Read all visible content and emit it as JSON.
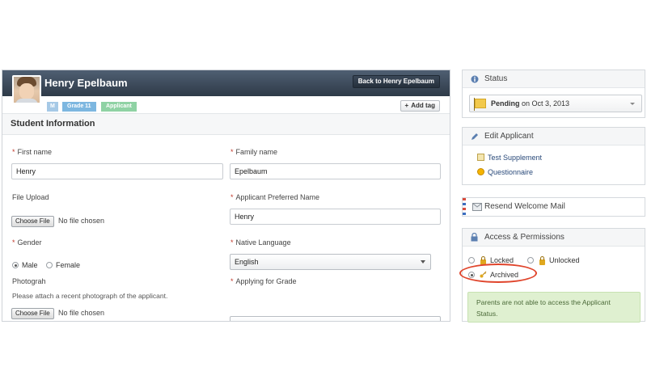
{
  "profile": {
    "name": "Henry Epelbaum",
    "back_button": "Back to Henry Epelbaum",
    "tags": [
      "M",
      "Grade 11",
      "Applicant"
    ],
    "add_tag": "Add tag"
  },
  "student_info": {
    "title": "Student Information",
    "first_name_label": "First name",
    "first_name_value": "Henry",
    "family_name_label": "Family name",
    "family_name_value": "Epelbaum",
    "file_upload_label": "File Upload",
    "choose_file": "Choose File",
    "no_file": "No file chosen",
    "preferred_name_label": "Applicant Preferred Name",
    "preferred_name_value": "Henry",
    "gender_label": "Gender",
    "gender_options": [
      "Male",
      "Female"
    ],
    "gender_selected": "Male",
    "native_language_label": "Native Language",
    "native_language_value": "English",
    "photograph_label": "Photograh",
    "photograph_help": "Please attach a recent photograph of the applicant.",
    "applying_grade_label": "Applying for Grade",
    "required_marker": "*"
  },
  "status_box": {
    "title": "Status",
    "status_value": "Pending",
    "status_date": " on Oct 3, 2013",
    "icon": "flag-icon"
  },
  "edit_box": {
    "title": "Edit Applicant",
    "links": [
      "Test Supplement",
      "Questionnaire"
    ]
  },
  "resend_box": {
    "title": "Resend Welcome Mail"
  },
  "access_box": {
    "title": "Access & Permissions",
    "options": [
      "Locked",
      "Unlocked",
      "Archived"
    ],
    "selected": "Archived",
    "info": "Parents are not able to access the Applicant Status."
  },
  "colors": {
    "header_dark": "#2e3a48",
    "info_green": "#dff0d0",
    "highlight_red": "#e0452c"
  }
}
